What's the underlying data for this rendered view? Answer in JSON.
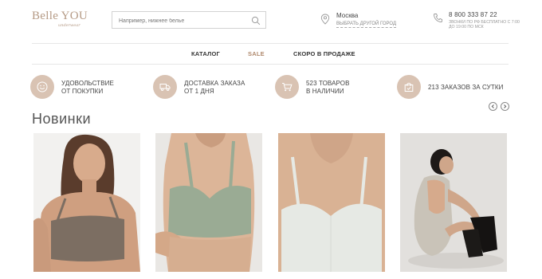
{
  "header": {
    "logo_main": "Belle YOU",
    "logo_sub": "underwear",
    "search_placeholder": "Например, нижнее белье",
    "city_name": "Москва",
    "city_change": "ВЫБРАТЬ ДРУГОЙ ГОРОД",
    "phone_number": "8 800 333 87 22",
    "phone_note": "ЗВОНКИ ПО РФ БЕСПЛАТНО С 7:00 ДО 19:00 ПО МСК"
  },
  "nav": {
    "items": [
      {
        "label": "КАТАЛОГ"
      },
      {
        "label": "SALE"
      },
      {
        "label": "СКОРО В ПРОДАЖЕ"
      }
    ]
  },
  "features": [
    {
      "text": "УДОВОЛЬСТВИЕ\nОТ ПОКУПКИ",
      "icon": "smile-icon"
    },
    {
      "text": "ДОСТАВКА ЗАКАЗА\nОТ 1 ДНЯ",
      "icon": "truck-icon"
    },
    {
      "text": "523 ТОВАРОВ\nВ НАЛИЧИИ",
      "icon": "cart-icon"
    },
    {
      "text": "213 ЗАКАЗОВ ЗА СУТКИ",
      "icon": "bag-icon"
    }
  ],
  "section": {
    "title": "Новинки"
  },
  "colors": {
    "accent": "#d9c3b3",
    "brand": "#b59a85",
    "sale": "#b08a6e",
    "product_1": "#7c6e62",
    "product_2": "#9aab94",
    "product_3": "#e6e9e4",
    "product_4": "#c9c3b8"
  }
}
